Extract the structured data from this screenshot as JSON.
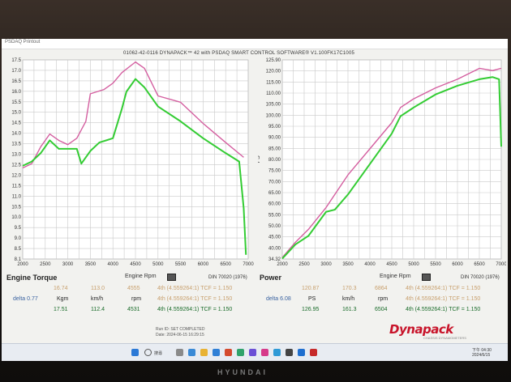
{
  "window": {
    "app_title": "PSDAQ Printout",
    "run_title": "01062-42-0116 DYNAPACK™ 42 with PSDAQ SMART CONTROL SOFTWARE® V1.100FK17C1005"
  },
  "torque_panel": {
    "label": "Engine Torque",
    "rpm_label": "Engine Rpm",
    "din": "DIN 70020 (1976)",
    "ylabel": "Kgm",
    "xticks": [
      "2000",
      "2500",
      "3000",
      "3500",
      "4000",
      "4500",
      "5000",
      "5500",
      "6000",
      "6500",
      "7000"
    ],
    "yticks": [
      "17.5",
      "17.0",
      "16.5",
      "16.0",
      "15.5",
      "15.0",
      "14.5",
      "14.0",
      "13.5",
      "13.0",
      "12.5",
      "12.0",
      "11.5",
      "11.0",
      "10.5",
      "10.0",
      "9.5",
      "9.0",
      "8.5",
      "8.1"
    ]
  },
  "power_panel": {
    "label": "Power",
    "rpm_label": "Engine Rpm",
    "din": "DIN 70020 (1976)",
    "ylabel": "PS",
    "xticks": [
      "2000",
      "2500",
      "3000",
      "3500",
      "4000",
      "4500",
      "5000",
      "5500",
      "6000",
      "6500",
      "7000"
    ],
    "yticks": [
      "125.90",
      "120.00",
      "115.00",
      "110.00",
      "105.00",
      "100.00",
      "95.00",
      "90.00",
      "85.00",
      "80.00",
      "75.00",
      "70.00",
      "65.00",
      "60.00",
      "55.00",
      "50.00",
      "45.00",
      "40.00",
      "34.32"
    ]
  },
  "torque_table": {
    "run1": {
      "kgm": "16.74",
      "kmh": "113.0",
      "rpm": "4555",
      "gear": "4th (4.559264:1) TCF = 1.150"
    },
    "header": {
      "delta": "delta 0.77",
      "kgm": "Kgm",
      "kmh": "km/h",
      "rpm": "rpm",
      "gear": "4th (4.559264:1) TCF = 1.150"
    },
    "run2": {
      "kgm": "17.51",
      "kmh": "112.4",
      "rpm": "4531",
      "gear": "4th (4.559264:1) TCF = 1.150"
    }
  },
  "power_table": {
    "run1": {
      "ps": "120.87",
      "kmh": "170.3",
      "rpm": "6864",
      "gear": "4th (4.559264:1) TCF = 1.150"
    },
    "header": {
      "delta": "delta 6.08",
      "ps": "PS",
      "kmh": "km/h",
      "rpm": "rpm",
      "gear": "4th (4.559264:1) TCF = 1.150"
    },
    "run2": {
      "ps": "126.95",
      "kmh": "161.3",
      "rpm": "6504",
      "gear": "4th (4.559264:1) TCF = 1.150"
    }
  },
  "status": {
    "line1": "Run ID: SET COMPLETED",
    "line2": "Date: 2024-06-15 16:29:15"
  },
  "logo": {
    "text": "Dynapack",
    "sub": "CHASSIS DYNAMOMETERS"
  },
  "taskbar": {
    "search_text": "搜尋",
    "time": "下午 04:30",
    "date": "2024/6/15"
  },
  "monitor_brand": "HYUNDAI",
  "colors": {
    "run1": "#d45fa0",
    "run2": "#33cc33",
    "logo": "#c8142a"
  },
  "chart_data": [
    {
      "type": "line",
      "xlabel": "Engine Rpm",
      "ylabel": "Kgm",
      "xlim": [
        2000,
        7000
      ],
      "ylim": [
        8.1,
        17.5
      ],
      "series": [
        {
          "color": "#d45fa0",
          "x": [
            2000,
            2200,
            2400,
            2600,
            2800,
            3000,
            3200,
            3400,
            3500,
            3800,
            4000,
            4200,
            4500,
            4700,
            5000,
            5500,
            6000,
            6500,
            6900
          ],
          "y": [
            12.4,
            12.6,
            13.4,
            14.0,
            13.7,
            13.5,
            13.8,
            14.6,
            15.9,
            16.1,
            16.4,
            16.9,
            17.4,
            17.1,
            15.8,
            15.5,
            14.5,
            13.6,
            12.9
          ]
        },
        {
          "color": "#33cc33",
          "x": [
            2000,
            2200,
            2400,
            2600,
            2800,
            3000,
            3200,
            3300,
            3500,
            3700,
            4000,
            4200,
            4300,
            4500,
            4700,
            5000,
            5500,
            6000,
            6500,
            6800,
            6900,
            6950
          ],
          "y": [
            12.5,
            12.7,
            13.1,
            13.7,
            13.3,
            13.3,
            13.3,
            12.6,
            13.2,
            13.6,
            13.8,
            15.2,
            16.0,
            16.6,
            16.2,
            15.3,
            14.6,
            13.8,
            13.1,
            12.7,
            10.5,
            8.3
          ]
        }
      ]
    },
    {
      "type": "line",
      "xlabel": "Engine Rpm",
      "ylabel": "PS",
      "xlim": [
        2000,
        7000
      ],
      "ylim": [
        34.32,
        125.9
      ],
      "series": [
        {
          "color": "#d45fa0",
          "x": [
            2000,
            2300,
            2600,
            3000,
            3500,
            4000,
            4500,
            4700,
            5000,
            5500,
            6000,
            6500,
            6800,
            7000
          ],
          "y": [
            35,
            42,
            48,
            58,
            73,
            85,
            97,
            104,
            108,
            113,
            117,
            122,
            121,
            122
          ]
        },
        {
          "color": "#33cc33",
          "x": [
            2000,
            2300,
            2600,
            3000,
            3200,
            3500,
            4000,
            4500,
            4700,
            5000,
            5500,
            6000,
            6500,
            6800,
            6950,
            7000
          ],
          "y": [
            34.5,
            41,
            45,
            56,
            57,
            64,
            78,
            92,
            100,
            104,
            110,
            114,
            117,
            118,
            117,
            86
          ]
        }
      ]
    }
  ]
}
